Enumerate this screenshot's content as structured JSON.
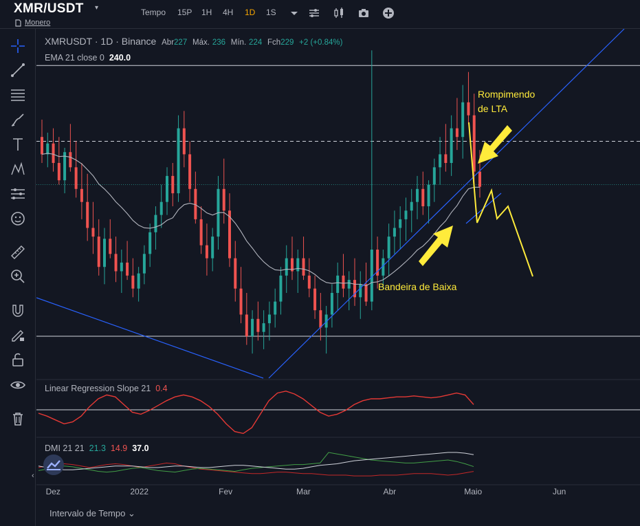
{
  "header": {
    "symbol": "XMR/USDT",
    "caret": "▾",
    "subname": "Monero",
    "tempo": "Tempo",
    "intervals": [
      "15P",
      "1H",
      "4H",
      "1D",
      "1S"
    ],
    "active_interval": "1D"
  },
  "legend": {
    "ticker": "XMRUSDT · 1D · Binance",
    "open_label": "Abr",
    "open": "227",
    "high_label": "Máx.",
    "high": "236",
    "low_label": "Mín.",
    "low": "224",
    "close_label": "Fch",
    "close": "229",
    "change": "+2 (+0.84%)",
    "ema_label": "EMA 21 close 0",
    "ema_value": "240.0",
    "lrs_label": "Linear Regression Slope 21",
    "lrs_value": "0.4",
    "dmi_label": "DMI 21 21",
    "dmi_plus": "21.3",
    "dmi_minus": "14.9",
    "dmi_adx": "37.0"
  },
  "annotations": {
    "top": [
      "Rompimendo",
      "de LTA"
    ],
    "bottom": "Bandeira de Baixa"
  },
  "footer": {
    "range_label": "Intervalo de Tempo ⌄"
  },
  "colors": {
    "background": "#131722",
    "up": "#26a69a",
    "down": "#ef5350",
    "trendline": "#2962ff",
    "annotation": "#ffeb3b",
    "ema": "#b2b5be",
    "lrs": "#e53935"
  },
  "chart_data": {
    "type": "candlestick",
    "x_ticks": [
      "Dez",
      "2022",
      "Fev",
      "Mar",
      "Abr",
      "Maio",
      "Jun"
    ],
    "x_range": [
      "2021-11-25",
      "2022-06-30"
    ],
    "y_range_price": [
      140,
      300
    ],
    "horizontal_levels": [
      285,
      250,
      230,
      160
    ],
    "ohlc": [
      [
        252,
        260,
        240,
        244
      ],
      [
        244,
        254,
        238,
        249
      ],
      [
        249,
        256,
        236,
        240
      ],
      [
        240,
        252,
        230,
        232
      ],
      [
        232,
        247,
        226,
        245
      ],
      [
        245,
        258,
        236,
        238
      ],
      [
        238,
        250,
        224,
        228
      ],
      [
        228,
        240,
        214,
        222
      ],
      [
        222,
        235,
        204,
        210
      ],
      [
        210,
        222,
        198,
        206
      ],
      [
        206,
        214,
        188,
        192
      ],
      [
        192,
        210,
        184,
        205
      ],
      [
        205,
        214,
        196,
        198
      ],
      [
        198,
        206,
        185,
        190
      ],
      [
        190,
        200,
        180,
        194
      ],
      [
        194,
        204,
        186,
        188
      ],
      [
        188,
        196,
        178,
        182
      ],
      [
        182,
        192,
        176,
        189
      ],
      [
        189,
        202,
        184,
        198
      ],
      [
        198,
        212,
        192,
        208
      ],
      [
        208,
        220,
        200,
        216
      ],
      [
        216,
        230,
        210,
        222
      ],
      [
        222,
        238,
        216,
        234
      ],
      [
        234,
        240,
        220,
        226
      ],
      [
        226,
        262,
        222,
        256
      ],
      [
        256,
        264,
        238,
        244
      ],
      [
        244,
        250,
        222,
        228
      ],
      [
        228,
        236,
        212,
        214
      ],
      [
        214,
        220,
        198,
        202
      ],
      [
        202,
        212,
        188,
        196
      ],
      [
        196,
        210,
        190,
        206
      ],
      [
        206,
        234,
        200,
        228
      ],
      [
        228,
        242,
        212,
        218
      ],
      [
        218,
        226,
        192,
        196
      ],
      [
        196,
        204,
        176,
        182
      ],
      [
        182,
        192,
        166,
        170
      ],
      [
        170,
        180,
        156,
        160
      ],
      [
        160,
        172,
        152,
        168
      ],
      [
        168,
        176,
        158,
        162
      ],
      [
        162,
        172,
        154,
        166
      ],
      [
        166,
        176,
        158,
        170
      ],
      [
        170,
        182,
        164,
        176
      ],
      [
        176,
        192,
        170,
        188
      ],
      [
        188,
        202,
        180,
        196
      ],
      [
        196,
        206,
        186,
        190
      ],
      [
        190,
        200,
        180,
        196
      ],
      [
        196,
        206,
        186,
        188
      ],
      [
        188,
        196,
        178,
        182
      ],
      [
        182,
        188,
        168,
        172
      ],
      [
        172,
        180,
        158,
        164
      ],
      [
        164,
        174,
        152,
        170
      ],
      [
        170,
        184,
        164,
        180
      ],
      [
        180,
        194,
        172,
        188
      ],
      [
        188,
        198,
        178,
        182
      ],
      [
        182,
        190,
        172,
        186
      ],
      [
        186,
        196,
        174,
        178
      ],
      [
        178,
        190,
        168,
        184
      ],
      [
        184,
        194,
        174,
        176
      ],
      [
        176,
        292,
        172,
        200
      ],
      [
        200,
        206,
        182,
        188
      ],
      [
        188,
        200,
        182,
        196
      ],
      [
        196,
        212,
        188,
        206
      ],
      [
        206,
        218,
        198,
        210
      ],
      [
        210,
        220,
        200,
        214
      ],
      [
        214,
        224,
        204,
        218
      ],
      [
        218,
        228,
        208,
        222
      ],
      [
        222,
        234,
        214,
        228
      ],
      [
        228,
        236,
        216,
        220
      ],
      [
        220,
        232,
        212,
        230
      ],
      [
        230,
        242,
        222,
        238
      ],
      [
        238,
        252,
        230,
        244
      ],
      [
        244,
        258,
        236,
        240
      ],
      [
        240,
        262,
        234,
        256
      ],
      [
        256,
        270,
        246,
        252
      ],
      [
        252,
        276,
        242,
        268
      ],
      [
        268,
        282,
        258,
        262
      ],
      [
        262,
        272,
        230,
        236
      ],
      [
        236,
        246,
        224,
        229
      ]
    ],
    "lrs_range": [
      -3,
      3
    ],
    "lrs": [
      -0.5,
      -0.8,
      -1.2,
      -1.6,
      -1.4,
      -0.8,
      0.2,
      1.0,
      1.4,
      1.2,
      0.4,
      -0.4,
      -0.6,
      -0.2,
      0.3,
      0.8,
      1.2,
      1.4,
      1.2,
      0.8,
      0.2,
      -0.6,
      -1.6,
      -2.4,
      -2.6,
      -2.0,
      -0.6,
      0.8,
      1.6,
      1.8,
      1.5,
      1.0,
      0.3,
      -0.4,
      -0.8,
      -0.6,
      -0.2,
      0.4,
      0.8,
      1.0,
      1.0,
      1.1,
      1.2,
      1.2,
      1.3,
      1.2,
      1.1,
      1.2,
      1.4,
      1.6,
      1.4,
      0.4
    ],
    "dmi_range": [
      0,
      60
    ],
    "dmi_plus": [
      16,
      18,
      20,
      22,
      21,
      19,
      17,
      15,
      14,
      15,
      17,
      19,
      20,
      18,
      16,
      15,
      14,
      16,
      18,
      19,
      18,
      17,
      16,
      15,
      17,
      19,
      20,
      21,
      22,
      23,
      24,
      24,
      25,
      26,
      40,
      38,
      36,
      34,
      32,
      30,
      29,
      28,
      27,
      26,
      26,
      27,
      28,
      29,
      30,
      28,
      25,
      21.3
    ],
    "dmi_minus": [
      20,
      22,
      24,
      25,
      24,
      22,
      20,
      22,
      24,
      25,
      24,
      22,
      20,
      22,
      24,
      26,
      25,
      22,
      20,
      18,
      17,
      16,
      15,
      14,
      13,
      12,
      12,
      13,
      14,
      14,
      13,
      12,
      12,
      11,
      10,
      10,
      10,
      9,
      9,
      9,
      10,
      10,
      10,
      11,
      12,
      12,
      12,
      11,
      10,
      11,
      13,
      14.9
    ],
    "dmi_adx": [
      22,
      20,
      18,
      17,
      17,
      18,
      19,
      20,
      21,
      22,
      22,
      22,
      21,
      20,
      20,
      21,
      22,
      22,
      21,
      20,
      20,
      21,
      22,
      23,
      23,
      22,
      21,
      20,
      19,
      18,
      18,
      19,
      21,
      23,
      24,
      25,
      27,
      29,
      30,
      31,
      32,
      33,
      34,
      35,
      36,
      37,
      38,
      39,
      40,
      40,
      39,
      37.0
    ]
  }
}
